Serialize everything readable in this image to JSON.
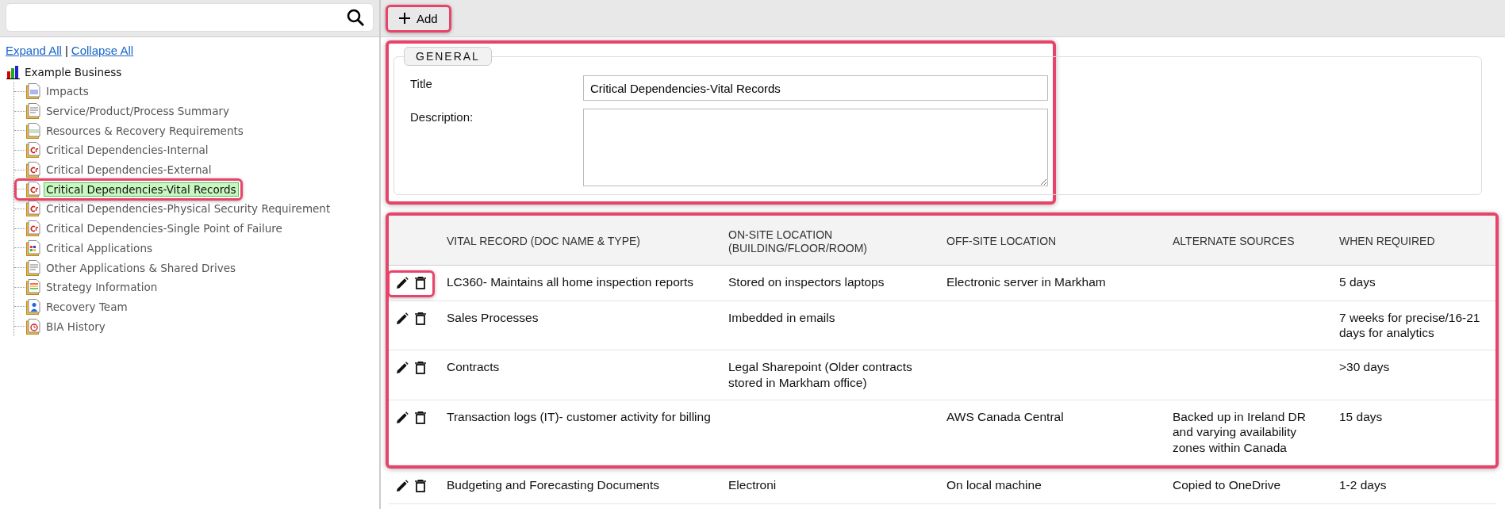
{
  "sidebar": {
    "expand_all": "Expand All",
    "separator": "|",
    "collapse_all": "Collapse All",
    "tree": {
      "label": "Example Business",
      "children": [
        {
          "label": "Impacts",
          "kind": "impacts",
          "selected": false,
          "highlighted": false
        },
        {
          "label": "Service/Product/Process Summary",
          "kind": "summary",
          "selected": false,
          "highlighted": false
        },
        {
          "label": "Resources & Recovery Requirements",
          "kind": "numbers",
          "selected": false,
          "highlighted": false
        },
        {
          "label": "Critical Dependencies-Internal",
          "kind": "dependency",
          "selected": false,
          "highlighted": false
        },
        {
          "label": "Critical Dependencies-External",
          "kind": "dependency",
          "selected": false,
          "highlighted": false
        },
        {
          "label": "Critical Dependencies-Vital Records",
          "kind": "dependency",
          "selected": true,
          "highlighted": true
        },
        {
          "label": "Critical Dependencies-Physical Security Requirement",
          "kind": "dependency",
          "selected": false,
          "highlighted": false
        },
        {
          "label": "Critical Dependencies-Single Point of Failure",
          "kind": "dependency",
          "selected": false,
          "highlighted": false
        },
        {
          "label": "Critical Applications",
          "kind": "applications",
          "selected": false,
          "highlighted": false
        },
        {
          "label": "Other Applications & Shared Drives",
          "kind": "drives",
          "selected": false,
          "highlighted": false
        },
        {
          "label": "Strategy Information",
          "kind": "strategy",
          "selected": false,
          "highlighted": false
        },
        {
          "label": "Recovery Team",
          "kind": "team",
          "selected": false,
          "highlighted": false
        },
        {
          "label": "BIA History",
          "kind": "history",
          "selected": false,
          "highlighted": false
        }
      ]
    }
  },
  "toolbar": {
    "add_button": {
      "label": "Add",
      "highlighted": true
    }
  },
  "general": {
    "legend": "GENERAL",
    "highlighted": true,
    "title_label": "Title",
    "title_value": "Critical Dependencies-Vital Records",
    "description_label": "Description:"
  },
  "table": {
    "highlighted": true,
    "columns": [
      "VITAL RECORD (DOC NAME & TYPE)",
      "ON-SITE LOCATION (BUILDING/FLOOR/ROOM)",
      "OFF-SITE LOCATION",
      "ALTERNATE SOURCES",
      "WHEN REQUIRED"
    ],
    "rows": [
      {
        "actions_highlighted": true,
        "cells": [
          "LC360- Maintains all home inspection reports",
          "Stored on inspectors laptops",
          "Electronic server in Markham",
          "",
          "5 days"
        ]
      },
      {
        "actions_highlighted": false,
        "cells": [
          "Sales Processes",
          "Imbedded in emails",
          "",
          "",
          "7 weeks for precise/16-21 days for analytics"
        ]
      },
      {
        "actions_highlighted": false,
        "cells": [
          "Contracts",
          "Legal Sharepoint (Older contracts stored in Markham office)",
          "",
          "",
          ">30 days"
        ]
      },
      {
        "actions_highlighted": false,
        "cells": [
          "Transaction logs (IT)- customer activity for billing",
          "",
          "AWS Canada Central",
          "Backed up in Ireland DR and varying availability zones within Canada",
          "15 days"
        ]
      }
    ],
    "extra_rows": [
      {
        "actions_highlighted": false,
        "cells": [
          "Budgeting and Forecasting Documents",
          "Electroni",
          "On local machine",
          "Copied to OneDrive",
          "1-2 days"
        ]
      }
    ]
  }
}
